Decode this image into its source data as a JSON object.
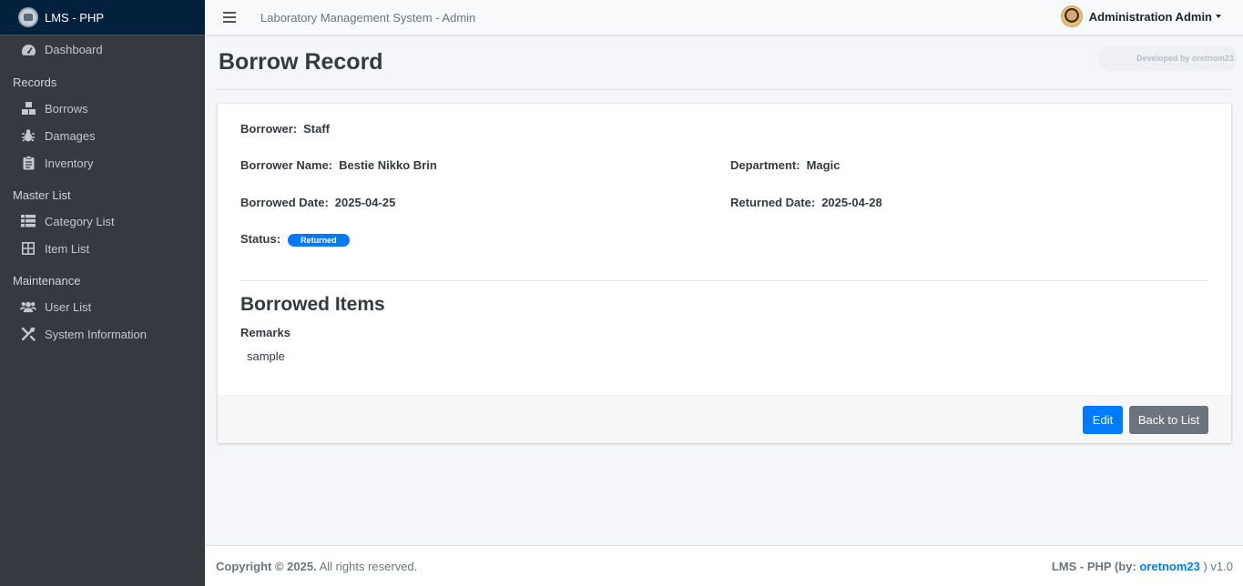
{
  "brand": {
    "name": "LMS - PHP"
  },
  "sidebar": {
    "dashboard": "Dashboard",
    "records_header": "Records",
    "records": [
      "Borrows",
      "Damages",
      "Inventory"
    ],
    "master_header": "Master List",
    "master": [
      "Category List",
      "Item List"
    ],
    "maintenance_header": "Maintenance",
    "maintenance": [
      "User List",
      "System Information"
    ]
  },
  "topbar": {
    "title": "Laboratory Management System - Admin",
    "user_name": "Administration Admin"
  },
  "page": {
    "title": "Borrow Record",
    "developed_by": "Developed by oretnom23"
  },
  "record": {
    "borrower_label": "Borrower:",
    "borrower": "Staff",
    "borrower_name_label": "Borrower Name:",
    "borrower_name": "Bestie Nikko Brin",
    "department_label": "Department:",
    "department": "Magic",
    "borrowed_date_label": "Borrowed Date:",
    "borrowed_date": "2025-04-25",
    "returned_date_label": "Returned Date:",
    "returned_date": "2025-04-28",
    "status_label": "Status:",
    "status": "Returned",
    "items_title": "Borrowed Items",
    "remarks_label": "Remarks",
    "remarks": "sample"
  },
  "actions": {
    "edit": "Edit",
    "back": "Back to List"
  },
  "footer": {
    "copyright_bold": "Copyright © 2025.",
    "copyright_rest": " All rights reserved.",
    "app": "LMS - PHP (by: ",
    "author": "oretnom23",
    "version_suffix": " ) v1.0"
  },
  "colors": {
    "sidebar_bg": "#343a40",
    "brand_bg": "#03203d",
    "primary": "#007bff",
    "secondary": "#6c757d"
  },
  "icons": {
    "dashboard": "tachometer-icon",
    "borrows": "boxes-icon",
    "damages": "bug-icon",
    "inventory": "clipboard-icon",
    "category_list": "list-icon",
    "item_list": "grid-icon",
    "user_list": "users-icon",
    "system_information": "tools-icon"
  }
}
